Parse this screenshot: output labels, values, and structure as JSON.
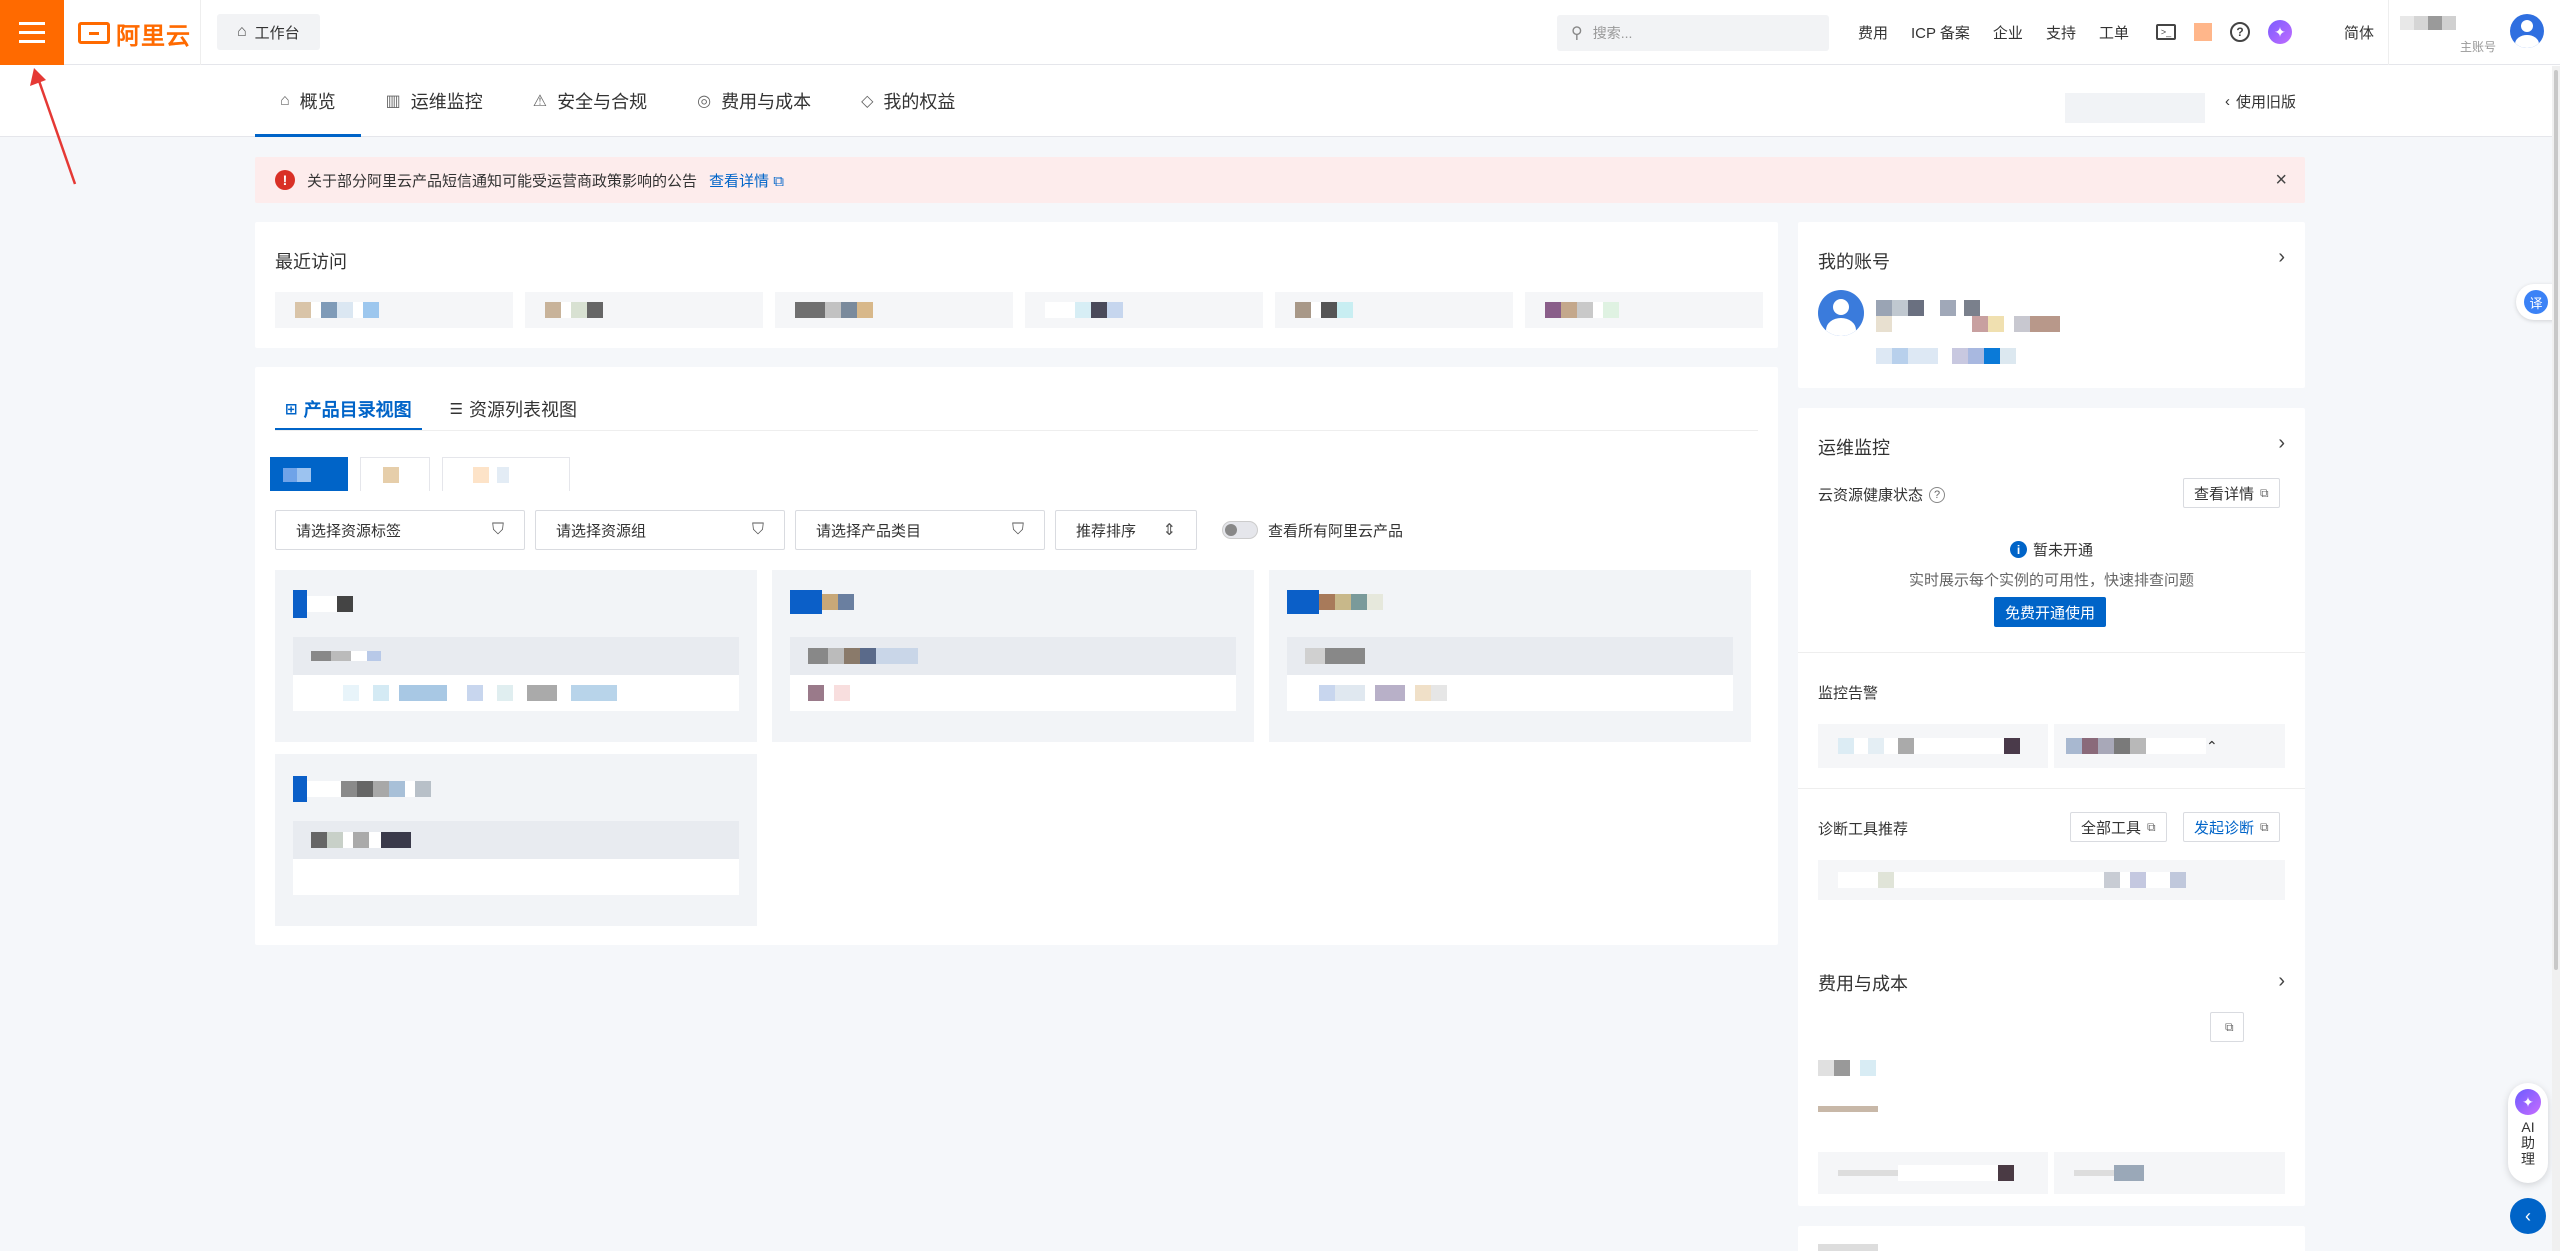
{
  "header": {
    "logo_text": "阿里云",
    "workbench_label": "工作台",
    "search_placeholder": "搜索...",
    "nav": [
      "费用",
      "ICP 备案",
      "企业",
      "支持",
      "工单"
    ],
    "language": "简体",
    "account_type": "主账号"
  },
  "tabs": [
    {
      "label": "概览",
      "icon": "home-icon"
    },
    {
      "label": "运维监控",
      "icon": "bar-chart-icon"
    },
    {
      "label": "安全与合规",
      "icon": "warning-icon"
    },
    {
      "label": "费用与成本",
      "icon": "coin-icon"
    },
    {
      "label": "我的权益",
      "icon": "diamond-icon"
    }
  ],
  "old_version_label": "使用旧版",
  "alert": {
    "text": "关于部分阿里云产品短信通知可能受运营商政策影响的公告",
    "link": "查看详情"
  },
  "recent": {
    "title": "最近访问"
  },
  "products": {
    "view_tabs": [
      "产品目录视图",
      "资源列表视图"
    ],
    "filters": [
      "请选择资源标签",
      "请选择资源组",
      "请选择产品类目"
    ],
    "sort_label": "推荐排序",
    "toggle_label": "查看所有阿里云产品"
  },
  "account": {
    "title": "我的账号"
  },
  "monitor": {
    "title": "运维监控",
    "health_label": "云资源健康状态",
    "view_details": "查看详情",
    "not_open": "暂未开通",
    "description": "实时展示每个实例的可用性，快速排查问题",
    "free_button": "免费开通使用",
    "alarm_label": "监控告警",
    "diag_label": "诊断工具推荐",
    "all_tools": "全部工具",
    "start_diag": "发起诊断"
  },
  "cost": {
    "title": "费用与成本"
  },
  "ai_assistant": {
    "label": "AI助理"
  },
  "colors": {
    "brand_orange": "#ff6a00",
    "primary_blue": "#0064c8",
    "alert_bg": "#fdecec",
    "alert_red": "#d93026"
  }
}
